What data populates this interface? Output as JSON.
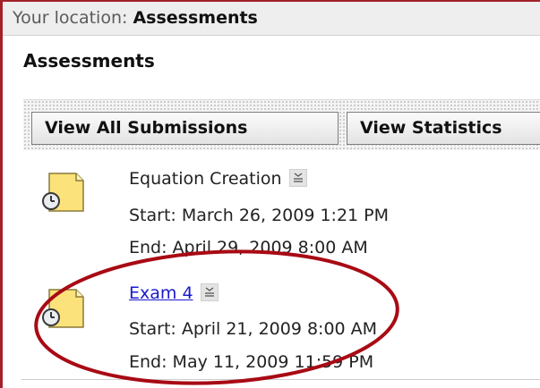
{
  "breadcrumb": {
    "prefix": "Your location:",
    "current": "Assessments"
  },
  "page": {
    "title": "Assessments"
  },
  "toolbar": {
    "view_all_label": "View All Submissions",
    "view_stats_label": "View Statistics"
  },
  "assessments": [
    {
      "title": "Equation Creation",
      "is_link": false,
      "start": "Start: March 26, 2009 1:21 PM",
      "end": "End: April 29, 2009 8:00 AM",
      "icon": "assessment-clock-icon",
      "menu_icon": "options-menu-icon"
    },
    {
      "title": "Exam 4",
      "is_link": true,
      "start": "Start: April 21, 2009 8:00 AM",
      "end": "End: May 11, 2009 11:59 PM",
      "icon": "assessment-clock-icon",
      "menu_icon": "options-menu-icon"
    }
  ],
  "colors": {
    "screenshot_border": "#a2222a",
    "highlight_ellipse": "#a80a14",
    "link": "#1a1acc",
    "icon_fill": "#fbe27a"
  }
}
